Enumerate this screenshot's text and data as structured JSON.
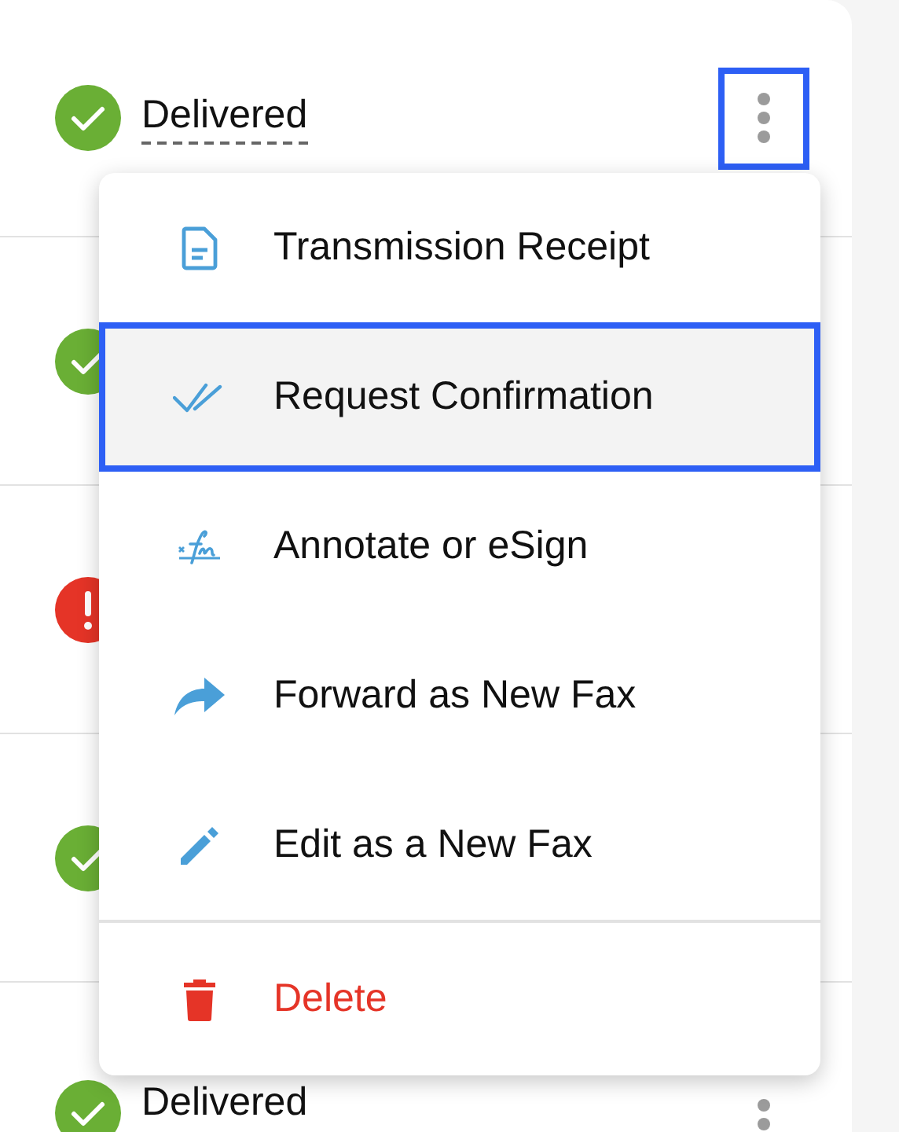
{
  "rows": [
    {
      "kind": "delivered",
      "label": "Delivered",
      "underlined": true,
      "menu_button": {
        "focused": true
      }
    },
    {
      "kind": "delivered"
    },
    {
      "kind": "error"
    },
    {
      "kind": "delivered"
    },
    {
      "kind": "delivered",
      "label": "Delivered",
      "underlined": false,
      "menu_button": {
        "focused": false
      }
    }
  ],
  "menu": {
    "items": [
      {
        "kind": "receipt",
        "label": "Transmission Receipt",
        "selected": false,
        "danger": false
      },
      {
        "kind": "confirm",
        "label": "Request Confirmation",
        "selected": true,
        "danger": false
      },
      {
        "kind": "sign",
        "label": "Annotate or eSign",
        "selected": false,
        "danger": false
      },
      {
        "kind": "forward",
        "label": "Forward as New Fax",
        "selected": false,
        "danger": false
      },
      {
        "kind": "edit",
        "label": "Edit as a New Fax",
        "selected": false,
        "danger": false
      },
      {
        "kind": "delete",
        "label": "Delete",
        "selected": false,
        "danger": true
      }
    ]
  }
}
